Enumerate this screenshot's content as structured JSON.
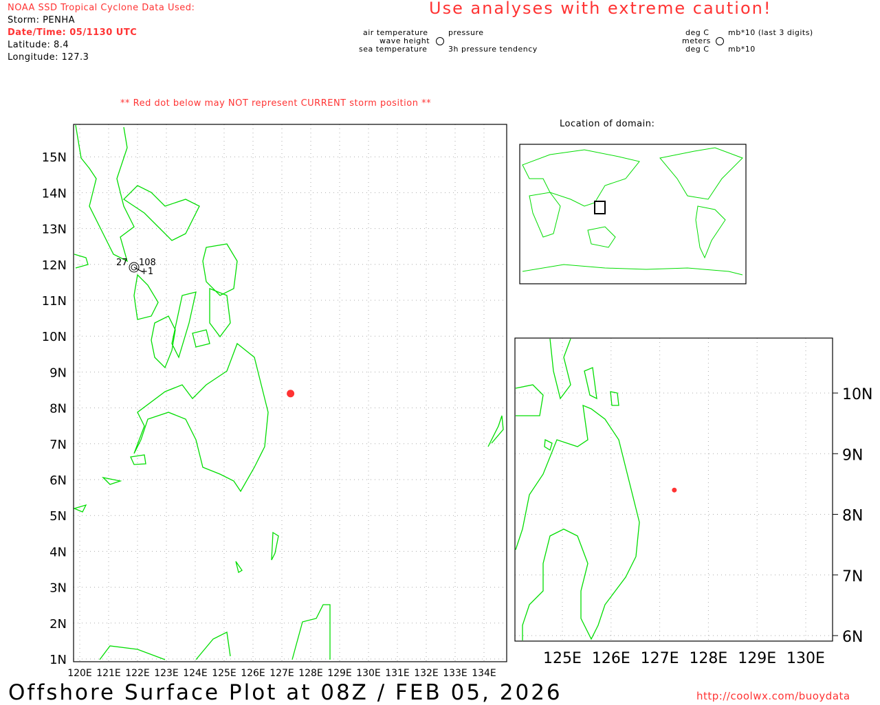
{
  "header": {
    "source": "NOAA SSD Tropical Cyclone Data Used:",
    "storm": "Storm: PENHA",
    "datetime": "Date/Time: 05/1130 UTC",
    "latitude": "Latitude: 8.4",
    "longitude": "Longitude: 127.3",
    "caution": "Use analyses with extreme caution!",
    "notice": "** Red dot below may NOT represent CURRENT storm position **"
  },
  "legend": {
    "air_temperature": "air temperature",
    "wave_height": "wave height",
    "sea_temperature": "sea temperature",
    "pressure": "pressure",
    "tendency": "3h pressure tendency",
    "deg_c_1": "deg C",
    "meters": "meters",
    "deg_c_2": "deg C",
    "mb_last3": "mb*10 (last 3 digits)",
    "mb": "mb*10"
  },
  "location_title": "Location of domain:",
  "footer": {
    "title": "Offshore Surface Plot at 08Z / FEB 05, 2026",
    "url": "http://coolwx.com/buoydata"
  },
  "colors": {
    "storm": "#f33",
    "coast": "#0d0",
    "grid": "#999"
  },
  "chart_data": {
    "type": "scatter",
    "main_map": {
      "lon_range": [
        119.8,
        134.8
      ],
      "lat_range": [
        0.9,
        15.9
      ],
      "x_ticks": [
        "120E",
        "121E",
        "122E",
        "123E",
        "124E",
        "125E",
        "126E",
        "127E",
        "128E",
        "129E",
        "130E",
        "131E",
        "132E",
        "133E",
        "134E"
      ],
      "y_ticks": [
        "1N",
        "2N",
        "3N",
        "4N",
        "5N",
        "6N",
        "7N",
        "8N",
        "9N",
        "10N",
        "11N",
        "12N",
        "13N",
        "14N",
        "15N"
      ],
      "storm": {
        "lon": 127.3,
        "lat": 8.4
      },
      "station": {
        "air_temp": "27",
        "pressure": "108",
        "tendency": "+1",
        "lon": 121.9,
        "lat": 11.9
      }
    },
    "zoom_map": {
      "x_ticks": [
        "125E",
        "126E",
        "127E",
        "128E",
        "129E",
        "130E"
      ],
      "y_ticks": [
        "6N",
        "7N",
        "8N",
        "9N",
        "10N"
      ],
      "storm": {
        "lon": 127.3,
        "lat": 8.4
      }
    }
  }
}
